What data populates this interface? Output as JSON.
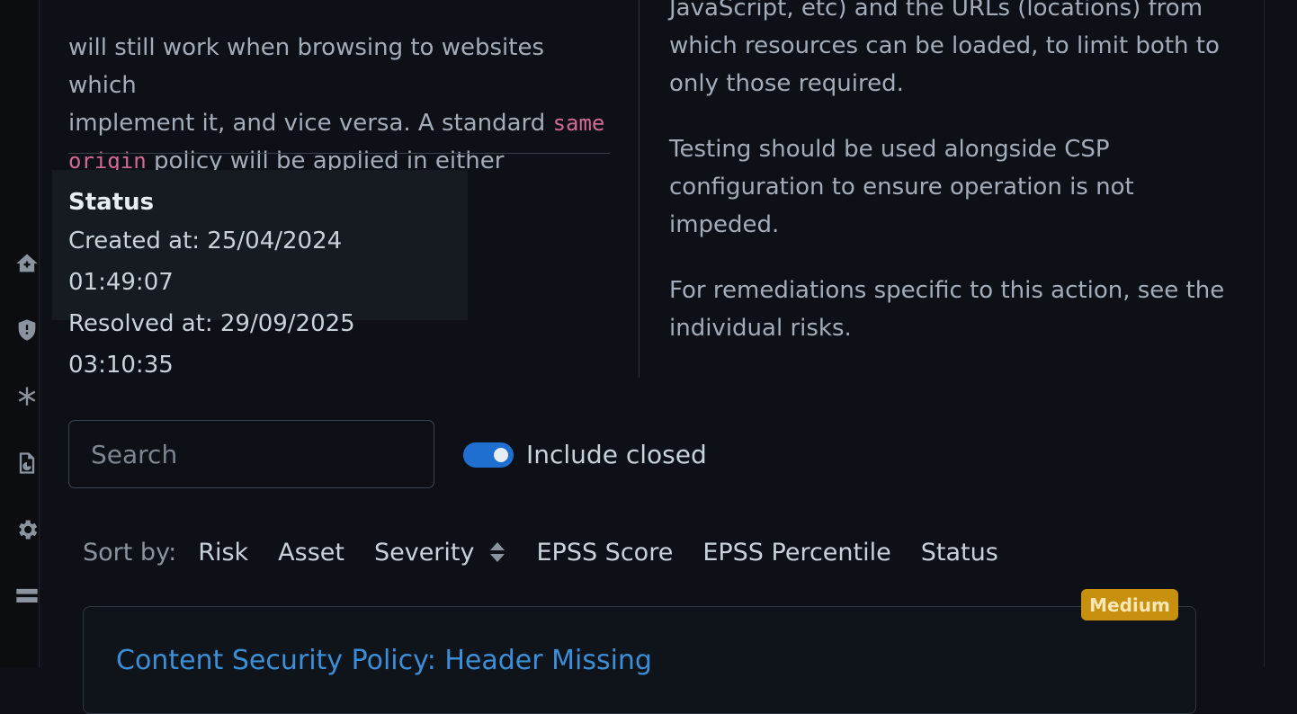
{
  "left_description": {
    "line1": "will still work when browsing to websites which",
    "line2": "implement it, and vice versa. A standard ",
    "code1": "same",
    "code2": "origin",
    "line3": " policy will be applied in either situation."
  },
  "status": {
    "title": "Status",
    "created": "Created at: 25/04/2024 01:49:07",
    "resolved": "Resolved at: 29/09/2025 03:10:35"
  },
  "right_description": {
    "p1": "JavaScript, etc) and the URLs (locations) from which resources can be loaded, to limit both to only those required.",
    "p2": "Testing should be used alongside CSP configuration to ensure operation is not impeded.",
    "p3": "For remediations specific to this action, see the individual risks."
  },
  "search": {
    "placeholder": "Search"
  },
  "toggle": {
    "label": "Include closed",
    "on": true
  },
  "sort": {
    "label": "Sort by:",
    "options": [
      "Risk",
      "Asset",
      "Severity",
      "EPSS Score",
      "EPSS Percentile",
      "Status"
    ]
  },
  "card": {
    "title": "Content Security Policy: Header Missing",
    "severity": "Medium"
  },
  "colors": {
    "accent": "#1f6fd0",
    "link": "#3b8fd8",
    "severity_medium": "#c8900f",
    "code": "#d36a93"
  },
  "sidebar_icons": [
    "home-plus-icon",
    "shield-alert-icon",
    "asterisk-icon",
    "report-chart-icon",
    "gear-icon",
    "server-icon"
  ]
}
